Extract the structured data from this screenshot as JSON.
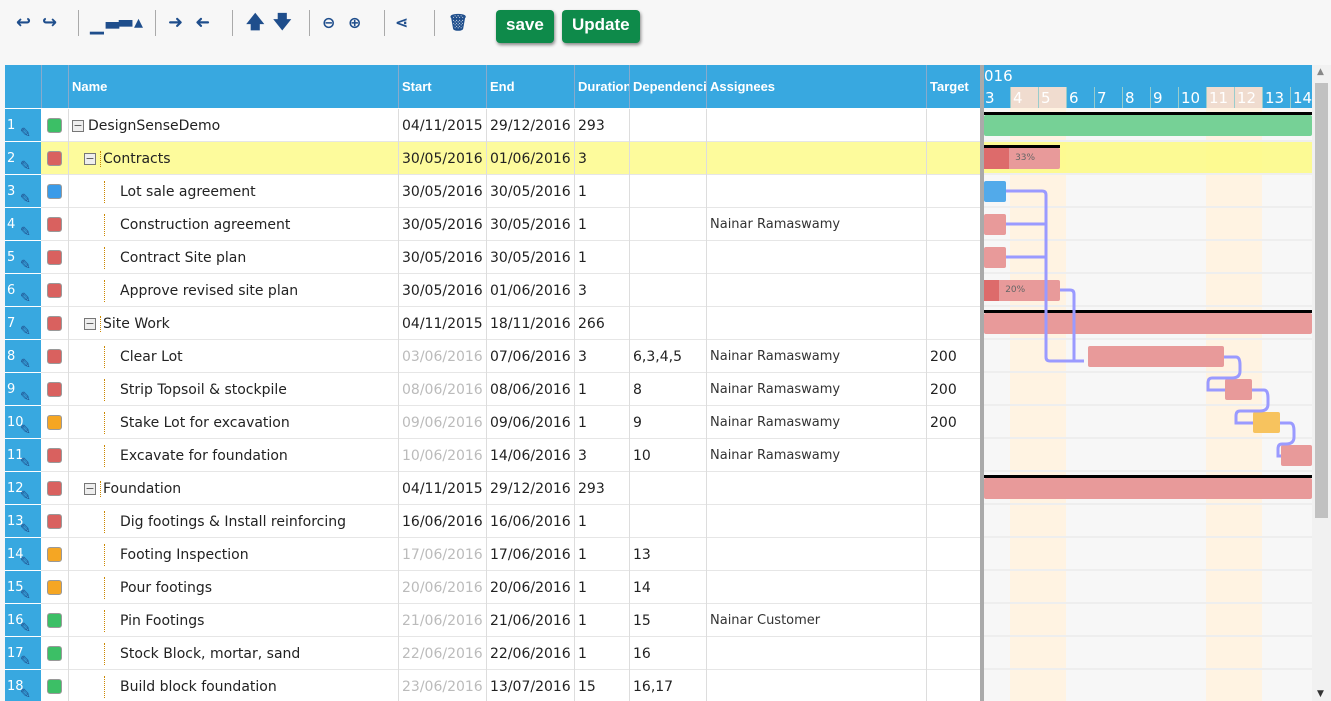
{
  "toolbar": {
    "icons": [
      "undo-icon",
      "redo-icon",
      "insert-above-icon",
      "insert-below-icon",
      "indent-icon",
      "outdent-icon",
      "move-up-icon",
      "move-down-icon",
      "zoom-out-icon",
      "zoom-in-icon",
      "link-icon",
      "trash-icon"
    ],
    "save_label": "save",
    "update_label": "Update"
  },
  "grid": {
    "columns": [
      "Name",
      "Start",
      "End",
      "Duration",
      "Dependencies",
      "Assignees",
      "Target"
    ],
    "rows": [
      {
        "n": "1",
        "color": "#3cbf66",
        "name": "DesignSenseDemo",
        "level": 0,
        "group": true,
        "start": "04/11/2015",
        "end": "29/12/2016",
        "dur": "293",
        "dep": "",
        "ass": "",
        "target": "",
        "gray": false
      },
      {
        "n": "2",
        "color": "#d9615f",
        "name": "Contracts",
        "level": 1,
        "group": true,
        "start": "30/05/2016",
        "end": "01/06/2016",
        "dur": "3",
        "dep": "",
        "ass": "",
        "target": "",
        "gray": false,
        "selected": true
      },
      {
        "n": "3",
        "color": "#3a9be8",
        "name": "Lot sale agreement",
        "level": 2,
        "start": "30/05/2016",
        "end": "30/05/2016",
        "dur": "1",
        "dep": "",
        "ass": "",
        "target": "",
        "gray": false
      },
      {
        "n": "4",
        "color": "#d9615f",
        "name": "Construction agreement",
        "level": 2,
        "start": "30/05/2016",
        "end": "30/05/2016",
        "dur": "1",
        "dep": "",
        "ass": "Nainar Ramaswamy",
        "target": "",
        "gray": false
      },
      {
        "n": "5",
        "color": "#d9615f",
        "name": "Contract Site plan",
        "level": 2,
        "start": "30/05/2016",
        "end": "30/05/2016",
        "dur": "1",
        "dep": "",
        "ass": "",
        "target": "",
        "gray": false
      },
      {
        "n": "6",
        "color": "#d9615f",
        "name": "Approve revised site plan",
        "level": 2,
        "start": "30/05/2016",
        "end": "01/06/2016",
        "dur": "3",
        "dep": "",
        "ass": "",
        "target": "",
        "gray": false
      },
      {
        "n": "7",
        "color": "#d9615f",
        "name": "Site Work",
        "level": 1,
        "group": true,
        "start": "04/11/2015",
        "end": "18/11/2016",
        "dur": "266",
        "dep": "",
        "ass": "",
        "target": "",
        "gray": false
      },
      {
        "n": "8",
        "color": "#d9615f",
        "name": "Clear Lot",
        "level": 2,
        "start": "03/06/2016",
        "end": "07/06/2016",
        "dur": "3",
        "dep": "6,3,4,5",
        "ass": "Nainar Ramaswamy",
        "target": "200",
        "gray": true
      },
      {
        "n": "9",
        "color": "#d9615f",
        "name": "Strip Topsoil & stockpile",
        "level": 2,
        "start": "08/06/2016",
        "end": "08/06/2016",
        "dur": "1",
        "dep": "8",
        "ass": "Nainar Ramaswamy",
        "target": "200",
        "gray": true
      },
      {
        "n": "10",
        "color": "#f5a623",
        "name": "Stake Lot for excavation",
        "level": 2,
        "start": "09/06/2016",
        "end": "09/06/2016",
        "dur": "1",
        "dep": "9",
        "ass": "Nainar Ramaswamy",
        "target": "200",
        "gray": true
      },
      {
        "n": "11",
        "color": "#d9615f",
        "name": "Excavate for foundation",
        "level": 2,
        "start": "10/06/2016",
        "end": "14/06/2016",
        "dur": "3",
        "dep": "10",
        "ass": "Nainar Ramaswamy",
        "target": "",
        "gray": true
      },
      {
        "n": "12",
        "color": "#d9615f",
        "name": "Foundation",
        "level": 1,
        "group": true,
        "start": "04/11/2015",
        "end": "29/12/2016",
        "dur": "293",
        "dep": "",
        "ass": "",
        "target": "",
        "gray": false
      },
      {
        "n": "13",
        "color": "#d9615f",
        "name": "Dig footings & Install reinforcing",
        "level": 2,
        "start": "16/06/2016",
        "end": "16/06/2016",
        "dur": "1",
        "dep": "",
        "ass": "",
        "target": "",
        "gray": false
      },
      {
        "n": "14",
        "color": "#f5a623",
        "name": "Footing Inspection",
        "level": 2,
        "start": "17/06/2016",
        "end": "17/06/2016",
        "dur": "1",
        "dep": "13",
        "ass": "",
        "target": "",
        "gray": true
      },
      {
        "n": "15",
        "color": "#f5a623",
        "name": "Pour footings",
        "level": 2,
        "start": "20/06/2016",
        "end": "20/06/2016",
        "dur": "1",
        "dep": "14",
        "ass": "",
        "target": "",
        "gray": true
      },
      {
        "n": "16",
        "color": "#3cbf66",
        "name": "Pin Footings",
        "level": 2,
        "start": "21/06/2016",
        "end": "21/06/2016",
        "dur": "1",
        "dep": "15",
        "ass": "Nainar Customer",
        "target": "",
        "gray": true
      },
      {
        "n": "17",
        "color": "#3cbf66",
        "name": "Stock Block, mortar, sand",
        "level": 2,
        "start": "22/06/2016",
        "end": "22/06/2016",
        "dur": "1",
        "dep": "16",
        "ass": "",
        "target": "",
        "gray": true
      },
      {
        "n": "18",
        "color": "#3cbf66",
        "name": "Build block foundation",
        "level": 2,
        "start": "23/06/2016",
        "end": "13/07/2016",
        "dur": "15",
        "dep": "16,17",
        "ass": "",
        "target": "",
        "gray": true
      }
    ]
  },
  "gantt": {
    "year_label": "016",
    "days": [
      "3",
      "4",
      "5",
      "6",
      "7",
      "8",
      "9",
      "10",
      "11",
      "12",
      "13",
      "14"
    ],
    "weekend_days": [
      "4",
      "5",
      "11",
      "12"
    ],
    "bars": [
      {
        "row": 1,
        "color": "#76d196",
        "summary": true
      },
      {
        "row": 2,
        "color": "#e89a9a",
        "progress_color": "#dd6b6b",
        "progress": "33%",
        "summary": true
      },
      {
        "row": 3,
        "color": "#52aaea"
      },
      {
        "row": 4,
        "color": "#e89a9a"
      },
      {
        "row": 5,
        "color": "#e89a9a"
      },
      {
        "row": 6,
        "color": "#e89a9a",
        "progress_color": "#dd6b6b",
        "progress": "20%"
      },
      {
        "row": 7,
        "color": "#e89a9a",
        "summary": true
      },
      {
        "row": 8,
        "color": "#e89a9a"
      },
      {
        "row": 9,
        "color": "#e89a9a"
      },
      {
        "row": 10,
        "color": "#f7c35e"
      },
      {
        "row": 11,
        "color": "#e89a9a"
      },
      {
        "row": 12,
        "color": "#e89a9a",
        "summary": true
      }
    ],
    "link_color": "#9a9aff"
  }
}
